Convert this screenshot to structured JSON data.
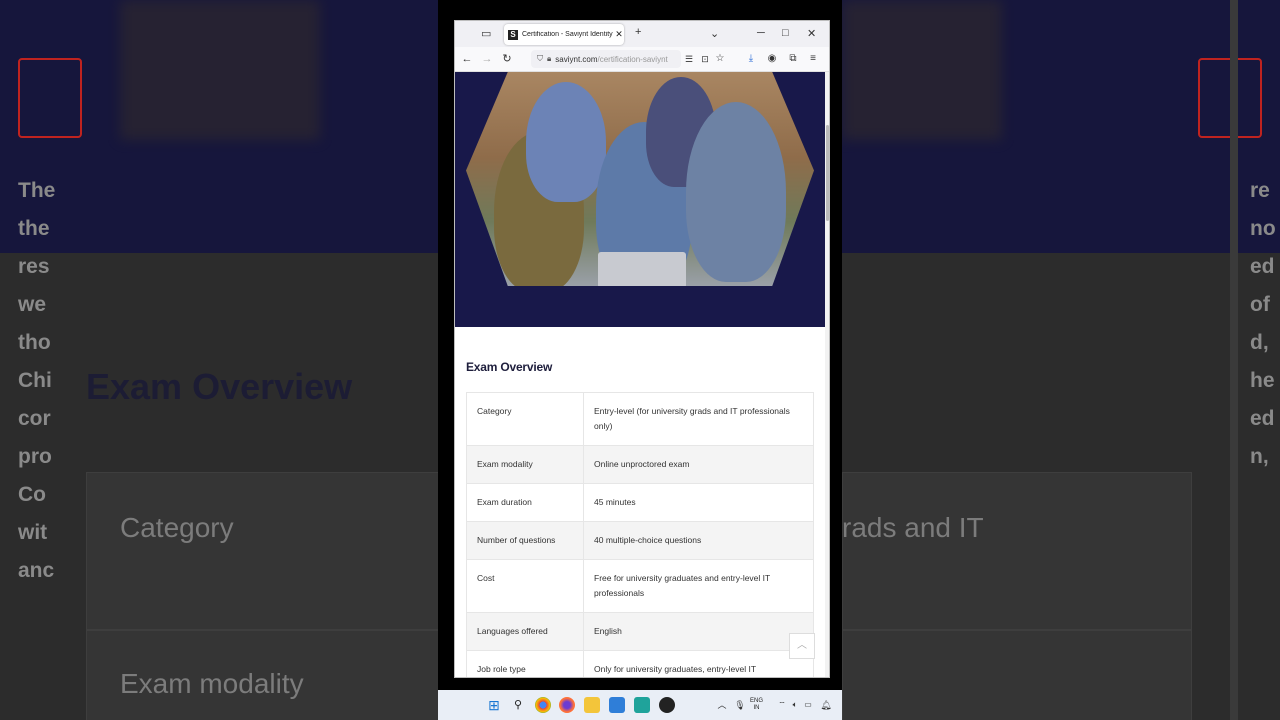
{
  "browser": {
    "tab_title": "Certification - Saviynt Identity S",
    "favicon_letter": "S",
    "url_host": "saviynt.com",
    "url_path": "/certification-saviynt",
    "new_tab": "+",
    "tab_close": "✕"
  },
  "page": {
    "section_title": "Exam Overview",
    "rows": [
      {
        "label": "Category",
        "value": "Entry-level (for university grads and IT professionals only)"
      },
      {
        "label": "Exam modality",
        "value": "Online unproctored exam"
      },
      {
        "label": "Exam duration",
        "value": "45 minutes"
      },
      {
        "label": "Number of questions",
        "value": "40 multiple-choice questions"
      },
      {
        "label": "Cost",
        "value": "Free for university graduates and entry-level IT professionals"
      },
      {
        "label": "Languages offered",
        "value": "English"
      },
      {
        "label": "Job role type",
        "value": "Only for university graduates, entry-level IT professionals interested in working with"
      }
    ]
  },
  "background": {
    "heading": "Exam Overview",
    "card1": "Category",
    "card2": "Exam modality",
    "card_right": "rads and IT",
    "left_lines": [
      "The",
      "the",
      "res",
      "we",
      "tho",
      "Chi",
      "cor",
      "pro",
      "Co",
      "wit",
      "anc"
    ],
    "right_lines": [
      "re",
      "no",
      "ed",
      "of",
      "d,",
      "he",
      "ed",
      "n,"
    ]
  },
  "taskbar": {
    "lang_line1": "ENG",
    "lang_line2": "IN"
  },
  "colors": {
    "hero_bg": "#18184a",
    "heading": "#1e1e3c",
    "taskbar": "#e9eef6"
  }
}
